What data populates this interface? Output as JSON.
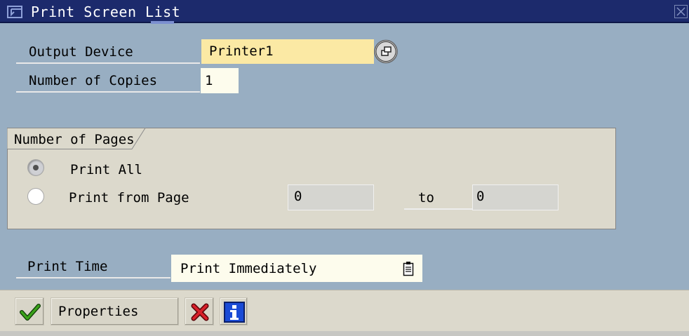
{
  "window": {
    "title": "Print Screen List"
  },
  "output_device": {
    "label": "Output Device",
    "value": "Printer1"
  },
  "copies": {
    "label": "Number of Copies",
    "value": "1"
  },
  "pages": {
    "group_title": "Number of Pages",
    "print_all_label": "Print All",
    "print_from_label": "Print from Page",
    "selected": "print_all",
    "from_value": "0",
    "to_label": "to",
    "to_value": "0"
  },
  "print_time": {
    "label": "Print Time",
    "value": "Print Immediately"
  },
  "footer": {
    "properties_label": "Properties"
  },
  "colors": {
    "title_bar": "#1c2a6c",
    "background": "#98aec2",
    "required_field": "#fbe9a4",
    "group_box": "#dcd9cc",
    "cancel_icon": "#c0141c",
    "info_icon": "#1a4bd6",
    "ok_icon": "#2a8f12"
  },
  "icons": {
    "window": "window-icon",
    "close": "close-icon",
    "match": "possible-entries-icon",
    "dropdown": "dropdown-list-icon",
    "ok": "checkmark-icon",
    "cancel": "cancel-x-icon",
    "info": "info-icon"
  }
}
